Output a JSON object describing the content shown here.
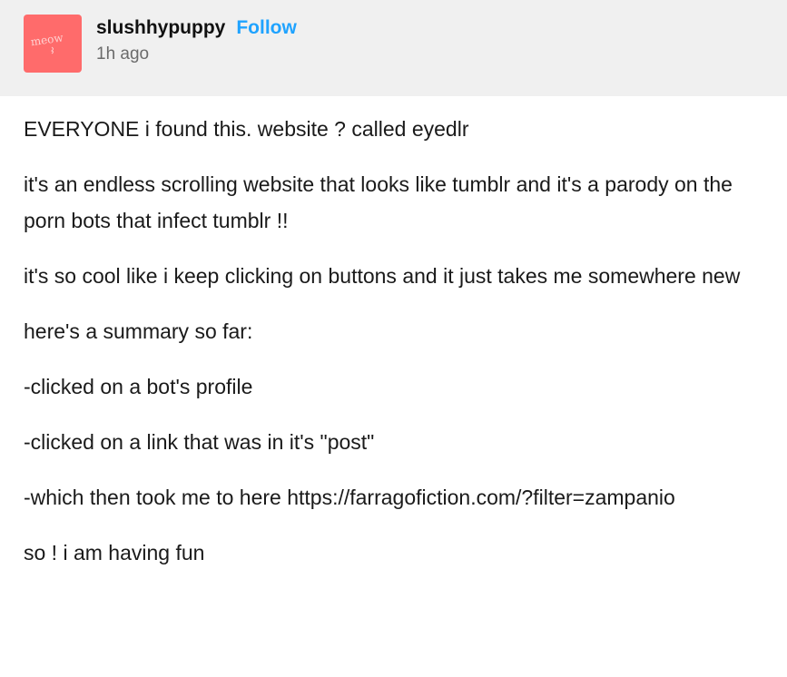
{
  "post": {
    "avatar": {
      "text": "meow",
      "color": "#ff6b6b"
    },
    "username": "slushhypuppy",
    "follow_label": "Follow",
    "timestamp": "1h ago",
    "colors": {
      "header_bg": "#f0f0f0",
      "follow_blue": "#1fa3ff"
    },
    "paragraphs": [
      "EVERYONE i found this. website ? called eyedlr",
      "it's an endless scrolling website that looks like tumblr and it's a parody on the porn bots that infect tumblr !!",
      "it's so cool like i keep clicking on buttons and it just takes me somewhere new",
      "here's a summary so far:",
      "-clicked on a bot's profile",
      "-clicked on a link that was in it's \"post\"",
      "-which then took me to here https://farragofiction.com/?filter=zampanio",
      "so !  i am having fun"
    ]
  }
}
